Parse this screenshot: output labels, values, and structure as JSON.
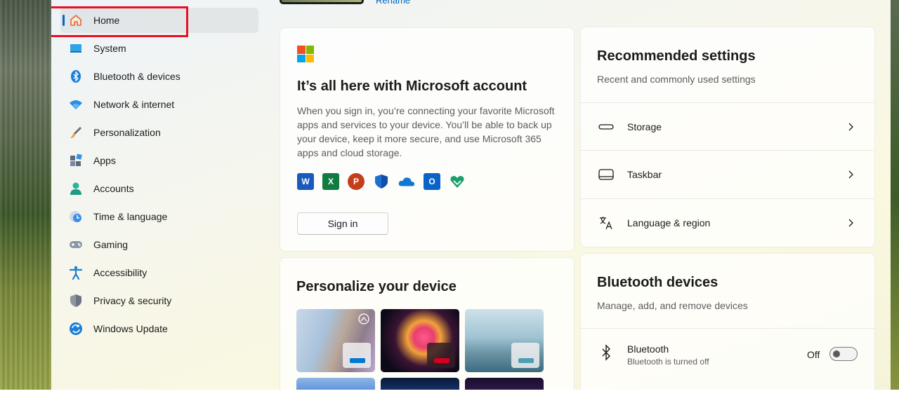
{
  "colors": {
    "accent": "#0067c0",
    "highlight": "#e81123"
  },
  "sidebar": {
    "items": [
      {
        "label": "Home",
        "icon": "home-icon"
      },
      {
        "label": "System",
        "icon": "system-icon"
      },
      {
        "label": "Bluetooth & devices",
        "icon": "bluetooth-icon"
      },
      {
        "label": "Network & internet",
        "icon": "wifi-icon"
      },
      {
        "label": "Personalization",
        "icon": "brush-icon"
      },
      {
        "label": "Apps",
        "icon": "apps-icon"
      },
      {
        "label": "Accounts",
        "icon": "accounts-icon"
      },
      {
        "label": "Time & language",
        "icon": "clock-globe-icon"
      },
      {
        "label": "Gaming",
        "icon": "gamepad-icon"
      },
      {
        "label": "Accessibility",
        "icon": "accessibility-icon"
      },
      {
        "label": "Privacy & security",
        "icon": "shield-icon"
      },
      {
        "label": "Windows Update",
        "icon": "update-icon"
      }
    ]
  },
  "header": {
    "rename_link": "Rename"
  },
  "ms_account": {
    "title": "It’s all here with Microsoft account",
    "description": "When you sign in, you’re connecting your favorite Microsoft apps and services to your device. You’ll be able to back up your device, keep it more secure, and use Microsoft 365 apps and cloud storage.",
    "apps": [
      "word-icon",
      "excel-icon",
      "powerpoint-icon",
      "defender-icon",
      "onedrive-icon",
      "outlook-icon",
      "family-icon"
    ],
    "sign_in_label": "Sign in"
  },
  "personalize": {
    "title": "Personalize your device"
  },
  "recommended": {
    "title": "Recommended settings",
    "subtitle": "Recent and commonly used settings",
    "rows": [
      {
        "label": "Storage",
        "icon": "storage-icon"
      },
      {
        "label": "Taskbar",
        "icon": "taskbar-icon"
      },
      {
        "label": "Language & region",
        "icon": "language-icon"
      }
    ]
  },
  "bluetooth": {
    "title": "Bluetooth devices",
    "subtitle": "Manage, add, and remove devices",
    "row_label": "Bluetooth",
    "row_status": "Bluetooth is turned off",
    "toggle_state": "Off",
    "toggle_on": false
  }
}
